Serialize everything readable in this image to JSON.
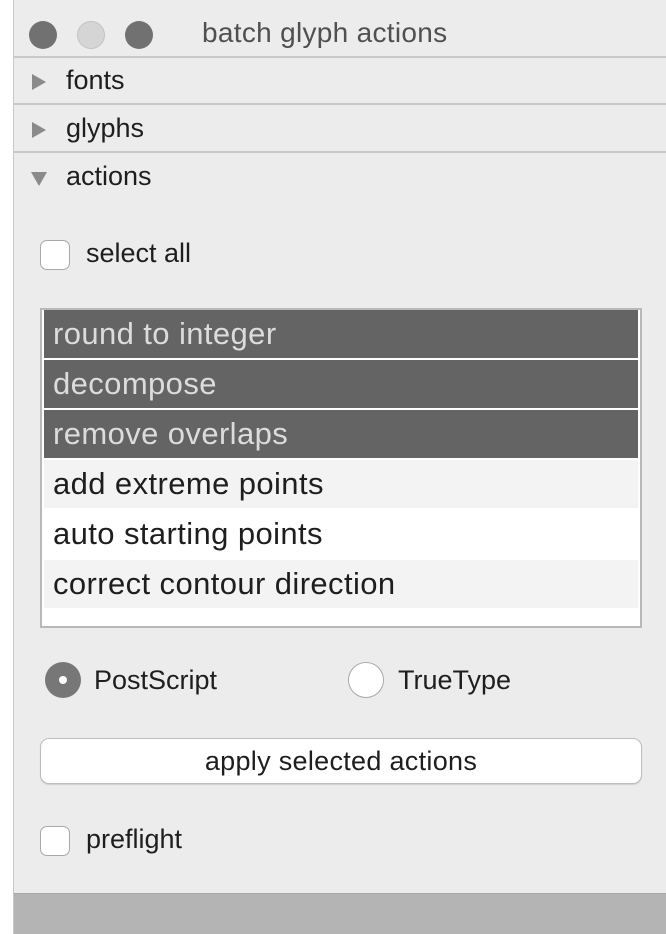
{
  "window": {
    "title": "batch glyph actions"
  },
  "sections": [
    {
      "label": "fonts",
      "expanded": false
    },
    {
      "label": "glyphs",
      "expanded": false
    },
    {
      "label": "actions",
      "expanded": true
    }
  ],
  "select_all": {
    "label": "select all",
    "checked": false
  },
  "actions": [
    {
      "label": "round to integer",
      "selected": true
    },
    {
      "label": "decompose",
      "selected": true
    },
    {
      "label": "remove overlaps",
      "selected": true
    },
    {
      "label": "add extreme points",
      "selected": false
    },
    {
      "label": "auto starting points",
      "selected": false
    },
    {
      "label": "correct contour direction",
      "selected": false
    }
  ],
  "outline_format": {
    "options": [
      "PostScript",
      "TrueType"
    ],
    "selected": "PostScript"
  },
  "apply_button": {
    "label": "apply selected actions"
  },
  "preflight": {
    "label": "preflight",
    "checked": false
  },
  "colors": {
    "selection": "#646464",
    "window_background": "#ececec"
  },
  "icons": {
    "collapsed": "disclosure-triangle-right-icon",
    "expanded": "disclosure-triangle-down-icon"
  }
}
